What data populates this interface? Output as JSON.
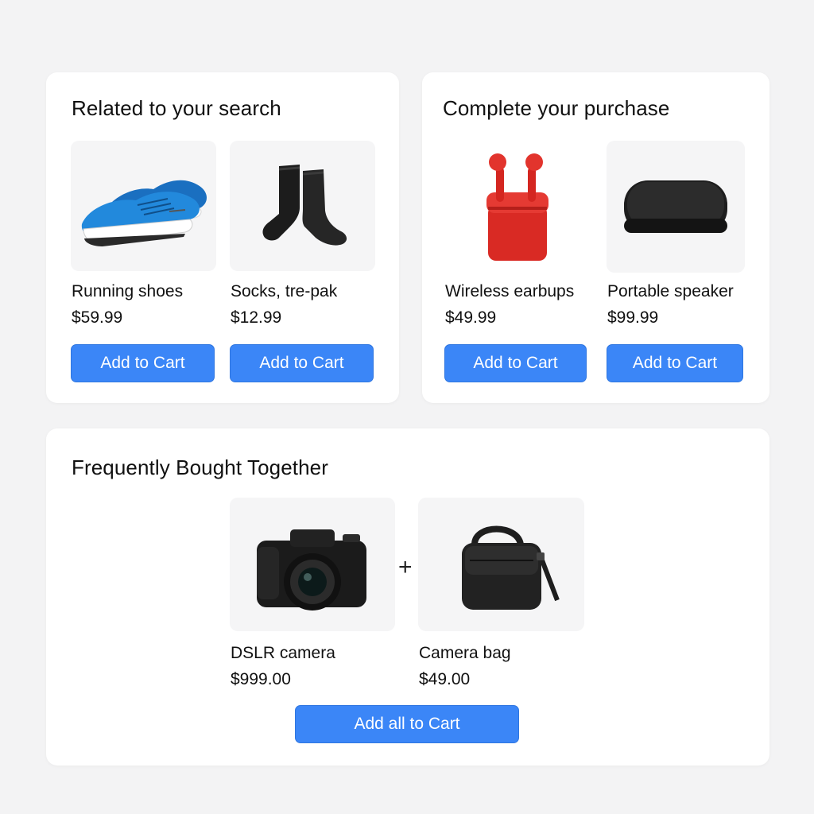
{
  "related": {
    "title": "Related to your search",
    "items": [
      {
        "name": "Running shoes",
        "price": "$59.99",
        "button": "Add to Cart",
        "icon": "running-shoes-image"
      },
      {
        "name": "Socks, tre-pak",
        "price": "$12.99",
        "button": "Add to Cart",
        "icon": "socks-image"
      }
    ]
  },
  "complete": {
    "title": "Complete your purchase",
    "items": [
      {
        "name": "Wireless earbups",
        "price": "$49.99",
        "button": "Add to Cart",
        "icon": "earbuds-image"
      },
      {
        "name": "Portable speaker",
        "price": "$99.99",
        "button": "Add to Cart",
        "icon": "speaker-image"
      }
    ]
  },
  "together": {
    "title": "Frequently Bought Together",
    "items": [
      {
        "name": "DSLR camera",
        "price": "$999.00",
        "icon": "dslr-camera-image"
      },
      {
        "name": "Camera bag",
        "price": "$49.00",
        "icon": "camera-bag-image"
      }
    ],
    "plus": "+",
    "button": "Add all to Cart"
  },
  "colors": {
    "accent": "#3b86f7",
    "background": "#f3f3f4",
    "card": "#ffffff",
    "thumb": "#f5f5f6",
    "shoe": "#1f7fd1",
    "earbuds": "#e02b25"
  }
}
